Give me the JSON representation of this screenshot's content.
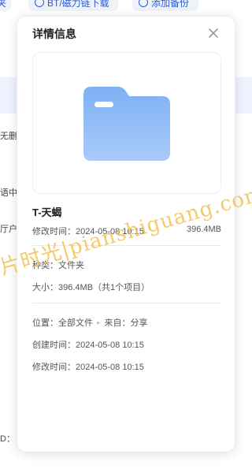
{
  "background": {
    "toolbar": {
      "left_label": "夹",
      "bt_label": "BT/磁力链下载",
      "add_label": "添加备份"
    },
    "fragments": [
      "无删",
      "语中",
      "厅户机",
      "D："
    ]
  },
  "watermark": "片时光|pianshiguang.com",
  "panel": {
    "title": "详情信息",
    "file": {
      "name": "T-天蝎",
      "modified_label": "修改时间：2024-05-08 10:15",
      "size_short": "396.4MB"
    },
    "type_line": "种类：文件夹",
    "size_line": "大小：396.4MB（共1个项目）",
    "location": {
      "prefix": "位置：全部文件",
      "arrow": "▸",
      "source": "来自：分享"
    },
    "created_line": "创建时间：2024-05-08 10:15",
    "modified_line": "修改时间：2024-05-08 10:15"
  },
  "colors": {
    "folder_top": "#7fb0f5",
    "folder_bottom": "#a9cbfa",
    "accent": "#2a5bd7"
  },
  "icons": {
    "close": "close-icon",
    "folder": "folder-icon"
  }
}
